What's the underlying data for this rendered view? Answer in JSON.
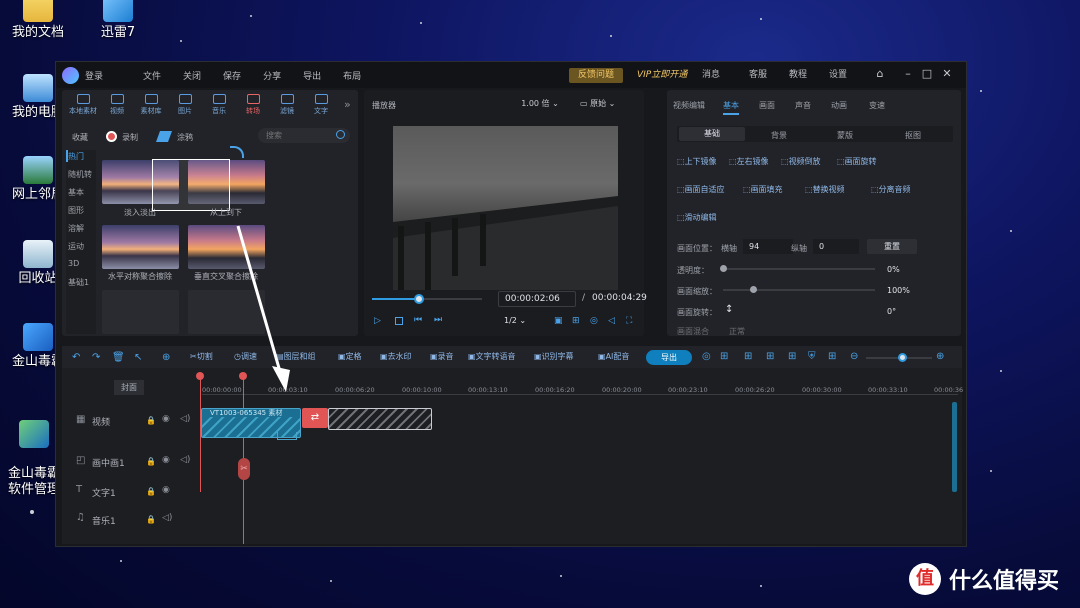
{
  "desktop": {
    "icons": [
      {
        "label": "我的文档",
        "icon": "folder-icon"
      },
      {
        "label": "迅雷7",
        "icon": "xunlei-icon"
      },
      {
        "label": "我的电脑",
        "icon": "computer-icon"
      },
      {
        "label": "网上邻居",
        "icon": "network-icon"
      },
      {
        "label": "回收站",
        "icon": "recycle-bin-icon"
      },
      {
        "label": "金山毒霸",
        "icon": "duba-icon"
      },
      {
        "label": "金山毒霸\n软件管理",
        "icon": "duba-software-icon"
      }
    ],
    "watermark": "什么值得买"
  },
  "titlebar": {
    "login": "登录",
    "menus": [
      "文件",
      "关闭",
      "保存",
      "分享",
      "导出",
      "布局"
    ],
    "feedback": "反馈问题",
    "vip": "VIP立即开通",
    "right": [
      "消息",
      "客服",
      "教程",
      "设置"
    ]
  },
  "media_panel": {
    "tools": [
      "本地素材",
      "视频",
      "素材库",
      "图片",
      "音乐",
      "转场",
      "滤镜",
      "文字"
    ],
    "active_tool": "转场",
    "subbar": {
      "fav": "收藏",
      "record": "录制",
      "paint": "涂鸦",
      "search_placeholder": "搜索"
    },
    "categories": [
      "热门",
      "随机转",
      "基本",
      "图形",
      "溶解",
      "运动",
      "3D",
      "基础1"
    ],
    "items": [
      {
        "label": "淡入淡出"
      },
      {
        "label": "从上到下"
      },
      {
        "label": "水平对称聚合擦除"
      },
      {
        "label": "垂直交叉聚合擦除"
      }
    ]
  },
  "player": {
    "title": "播放器",
    "speed": "1.00 倍",
    "ratio": "原始",
    "current": "00:00:02:06",
    "separator": "/",
    "total": "00:00:04:29",
    "quality": "1/2",
    "progress": 0.43
  },
  "props": {
    "tabs": [
      "视频编辑",
      "基本",
      "画面",
      "声音",
      "动画",
      "变速"
    ],
    "subtabs": [
      "基础",
      "背景",
      "蒙版",
      "抠图"
    ],
    "buttons_row1": [
      "上下镜像",
      "左右镜像",
      "视频倒放",
      "画面旋转"
    ],
    "buttons_row2": [
      "画面自适应",
      "画面填充",
      "替换视频",
      "分离音频"
    ],
    "buttons_row3": [
      "滑动编辑"
    ],
    "position_label": "画面位置：",
    "x_label": "横轴",
    "x_value": "94",
    "y_label": "纵轴",
    "y_value": "0",
    "reset": "重置",
    "opacity_label": "透明度：",
    "opacity_value": "0%",
    "opacity_level": 0.0,
    "scale_label": "画面缩放：",
    "scale_value": "100%",
    "scale_level": 0.2,
    "rotate_label": "画面旋转：",
    "rotate_value": "0°",
    "mix_label": "画面混合",
    "mix_value": "正常"
  },
  "timeline": {
    "toolbar": [
      "切割",
      "调速",
      "图层和组",
      "定格",
      "去水印",
      "录音",
      "文字转语音",
      "识别字幕",
      "AI配音"
    ],
    "export": "导出",
    "cover": "封面",
    "ruler": [
      "00:00:00:00",
      "00:00:03:10",
      "00:00:06:20",
      "00:00:10:00",
      "00:00:13:10",
      "00:00:16:20",
      "00:00:20:00",
      "00:00:23:10",
      "00:00:26:20",
      "00:00:30:00",
      "00:00:33:10",
      "00:00:36"
    ],
    "tracks": [
      {
        "label": "视频",
        "icon": "film-icon"
      },
      {
        "label": "画中画1",
        "icon": "pip-icon"
      },
      {
        "label": "文字1",
        "icon": "text-icon"
      },
      {
        "label": "音乐1",
        "icon": "music-icon"
      }
    ],
    "clip_label": "VT1003-065345",
    "clip_label2": "素材"
  },
  "colors": {
    "accent": "#0f7fbd",
    "active": "#e86565",
    "vip": "#f3c868"
  }
}
